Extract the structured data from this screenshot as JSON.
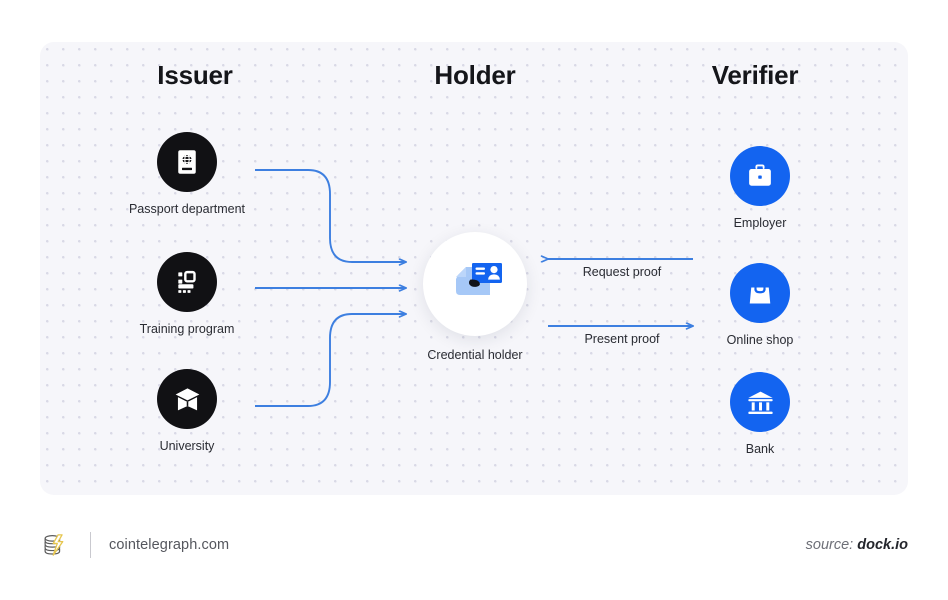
{
  "diagram": {
    "columns": [
      {
        "key": "issuer",
        "heading": "Issuer"
      },
      {
        "key": "holder",
        "heading": "Holder"
      },
      {
        "key": "verifier",
        "heading": "Verifier"
      }
    ],
    "issuers": [
      {
        "label": "Passport department",
        "icon": "passport-icon",
        "circle_color": "#111114"
      },
      {
        "label": "Training program",
        "icon": "sitemap-icon",
        "circle_color": "#111114"
      },
      {
        "label": "University",
        "icon": "graduation-cap-icon",
        "circle_color": "#111114"
      }
    ],
    "holder": {
      "label": "Credential holder",
      "icon": "hand-holding-id-card-icon",
      "circle_color": "#ffffff"
    },
    "verifiers": [
      {
        "label": "Employer",
        "icon": "briefcase-icon",
        "circle_color": "#1364f0"
      },
      {
        "label": "Online shop",
        "icon": "shopping-bag-icon",
        "circle_color": "#1364f0"
      },
      {
        "label": "Bank",
        "icon": "bank-icon",
        "circle_color": "#1364f0"
      }
    ],
    "flows": [
      {
        "label": "Request proof",
        "direction": "verifier-to-holder"
      },
      {
        "label": "Present proof",
        "direction": "holder-to-verifier"
      }
    ],
    "colors": {
      "panel_background": "#f6f6fa",
      "dot_grid": "#d9d9e6",
      "connector_blue": "#3d7fe0",
      "accent_blue": "#1364f0",
      "dark": "#111114",
      "heading_text": "#15161a",
      "label_text": "#2a2c33"
    }
  },
  "footer": {
    "logo_icon": "cointelegraph-logo",
    "url": "cointelegraph.com",
    "source_prefix": "source: ",
    "source_name": "dock.io"
  }
}
